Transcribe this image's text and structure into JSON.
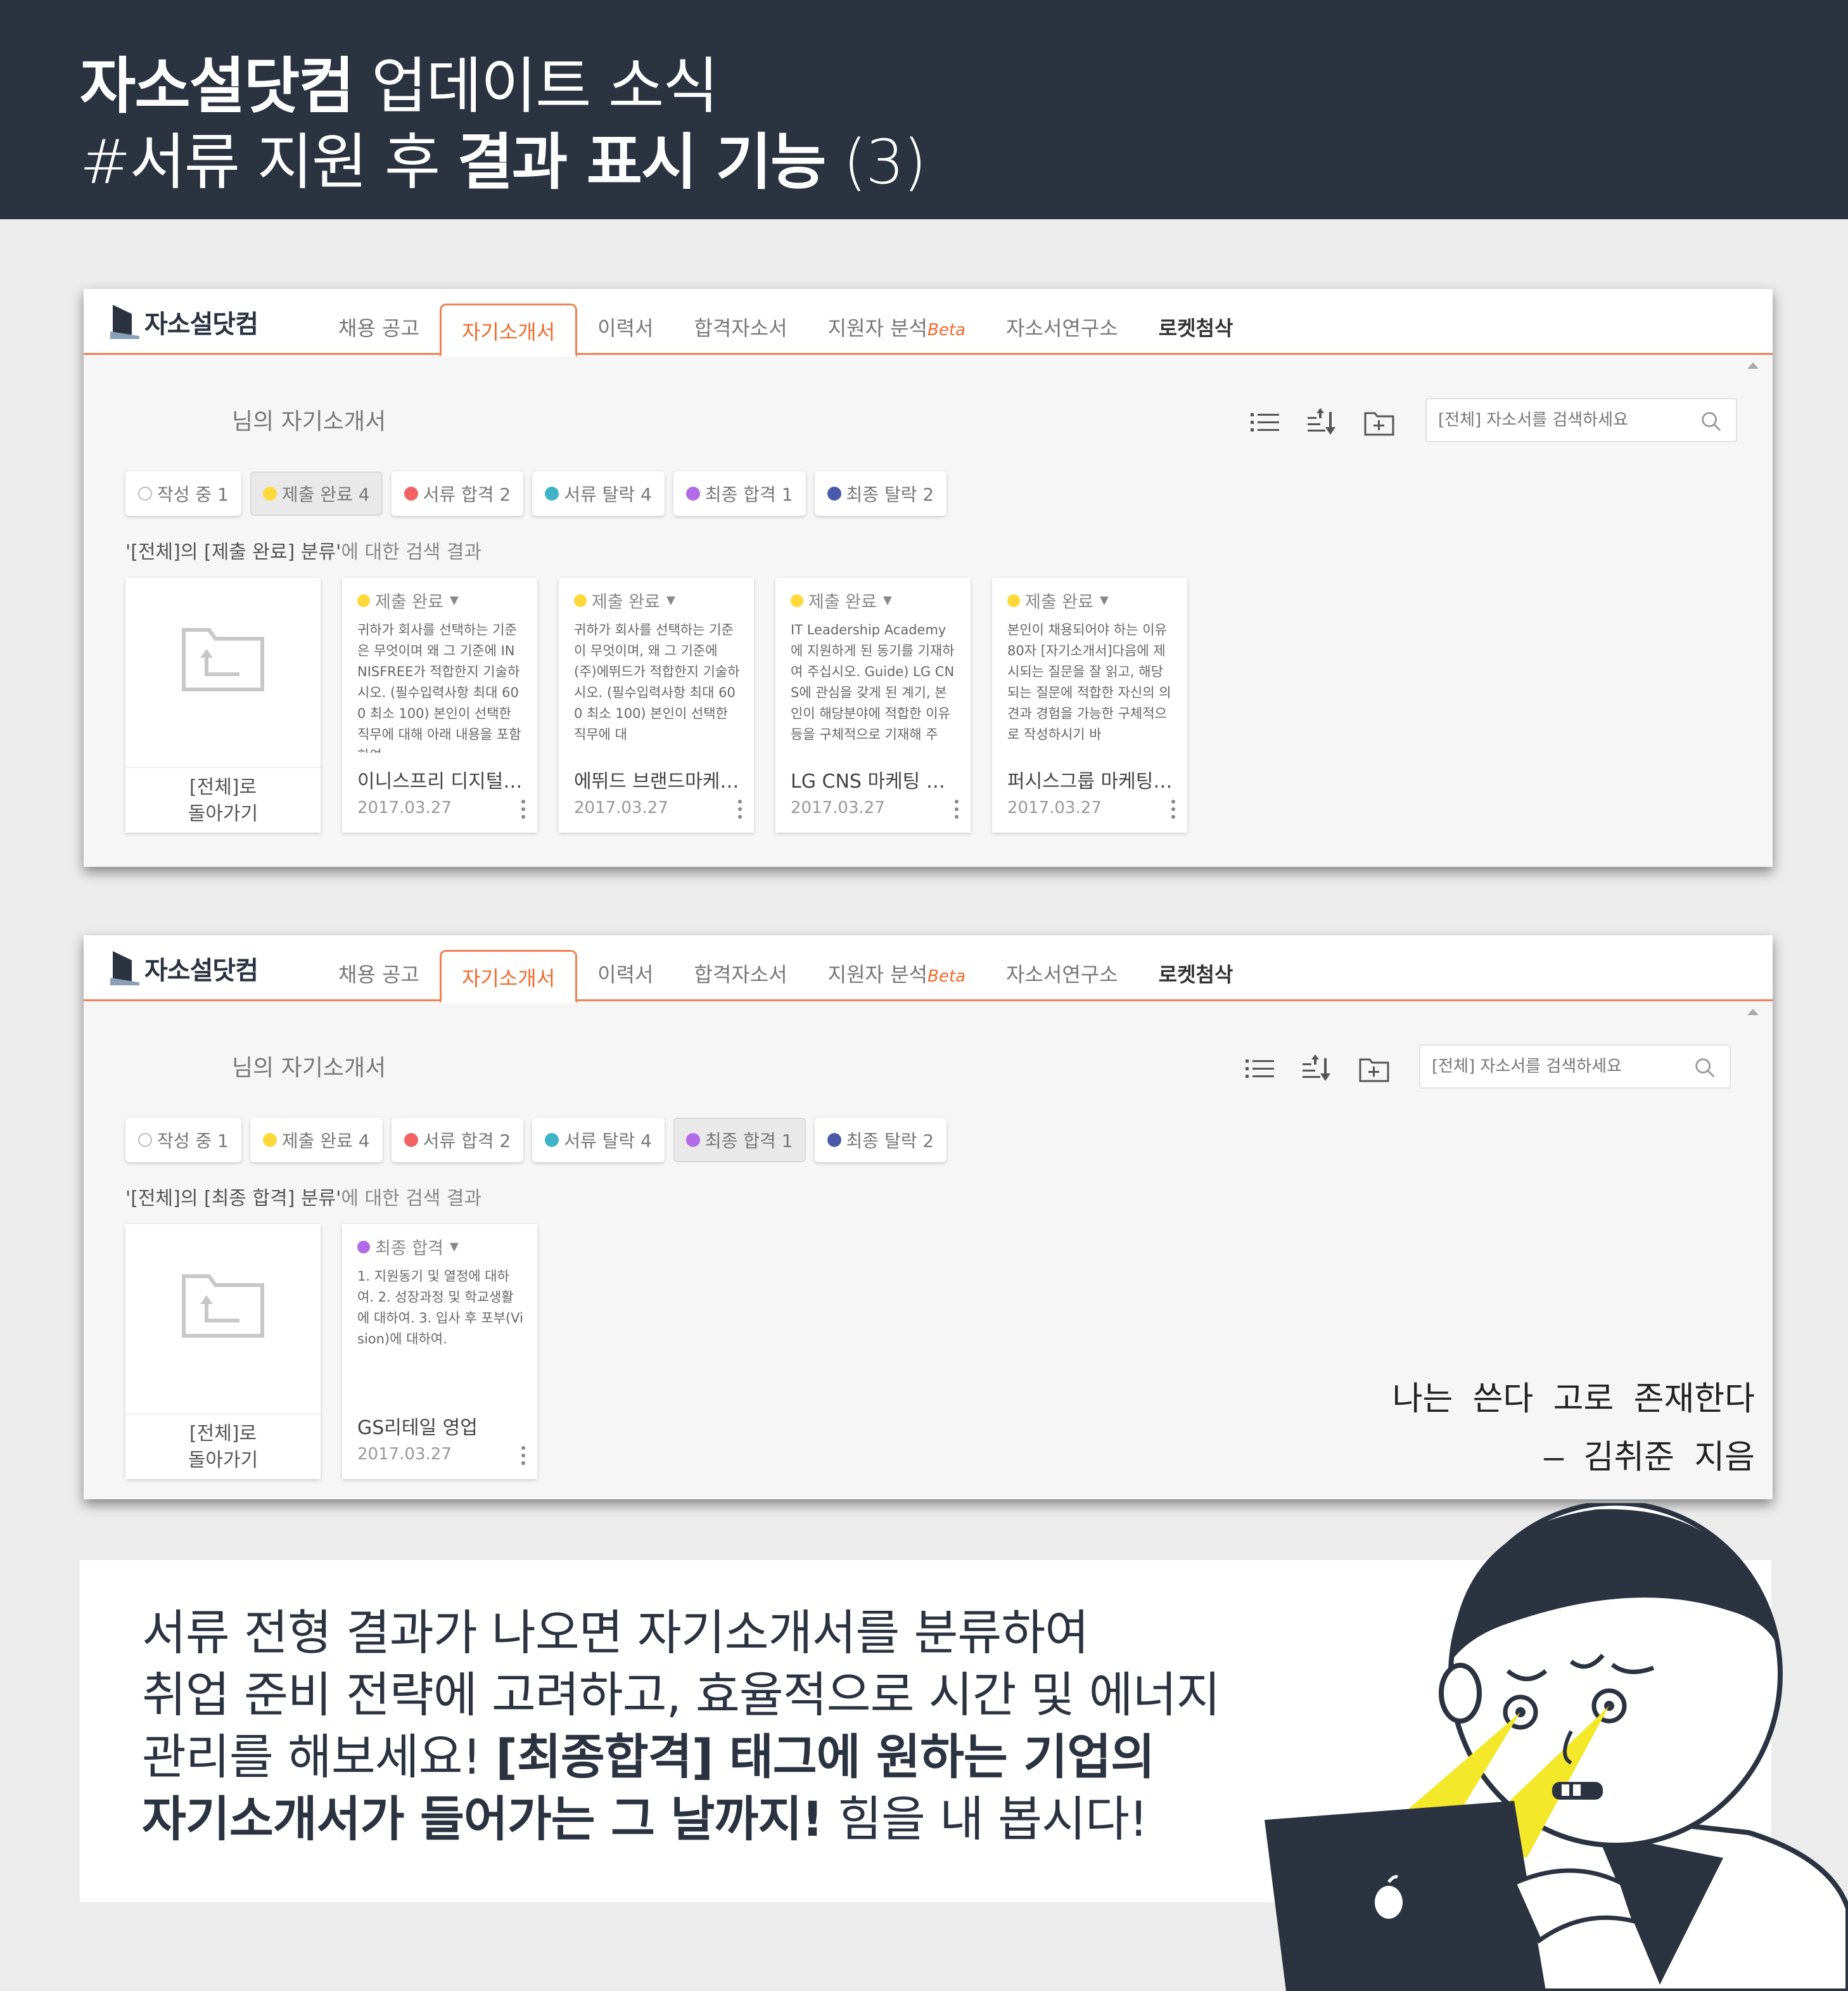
{
  "banner": {
    "line1_bold": "자소설닷컴",
    "line1_rest": " 업데이트 소식",
    "line2_pre": "#서류 지원 후 ",
    "line2_bold": "결과 표시 기능",
    "line2_post": " (3)"
  },
  "site": {
    "logo_text": "자소설닷컴",
    "tabs": [
      {
        "label": "채용 공고"
      },
      {
        "label": "자기소개서"
      },
      {
        "label": "이력서"
      },
      {
        "label": "합격자소서"
      },
      {
        "label": "지원자 분석",
        "badge": "Beta"
      },
      {
        "label": "자소서연구소"
      },
      {
        "label": "로켓첨삭"
      }
    ],
    "owner_label": "님의 자기소개서",
    "search_placeholder": "[전체] 자소서를 검색하세요",
    "icons": [
      "list-view-icon",
      "sort-icon",
      "new-folder-icon",
      "search-icon"
    ]
  },
  "chips": [
    {
      "label": "작성 중 1",
      "color": "hollow"
    },
    {
      "label": "제출 완료 4",
      "color": "#ffd83a"
    },
    {
      "label": "서류 합격 2",
      "color": "#f26464"
    },
    {
      "label": "서류 탈락 4",
      "color": "#3fb4c6"
    },
    {
      "label": "최종 합격 1",
      "color": "#b26ae6"
    },
    {
      "label": "최종 탈락 2",
      "color": "#4b5aa8"
    }
  ],
  "panel1": {
    "selected_chip": 1,
    "result_bold": "'[전체]의 [제출 완료] 분류'",
    "result_rest": "에 대한 검색 결과",
    "back_card": {
      "line1": "[전체]로",
      "line2": "돌아가기"
    },
    "cards": [
      {
        "status": "제출 완료",
        "status_color": "#ffd83a",
        "body": "귀하가 회사를 선택하는 기준은 무엇이며 왜 그 기준에 INNISFREE가 적합한지 기술하시오. (필수입력사항 최대 600 최소 100) 본인이 선택한 직무에 대해 아래 내용을 포함하여",
        "title": "이니스프리 디지털…",
        "date": "2017.03.27"
      },
      {
        "status": "제출 완료",
        "status_color": "#ffd83a",
        "body": "귀하가 회사를 선택하는 기준이 무엇이며, 왜 그 기준에 (주)에뛰드가 적합한지 기술하시오. (필수입력사항 최대 600 최소 100) 본인이 선택한 직무에 대",
        "title": "에뛰드 브랜드마케…",
        "date": "2017.03.27"
      },
      {
        "status": "제출 완료",
        "status_color": "#ffd83a",
        "body": "IT Leadership Academy에 지원하게 된 동기를 기재하여 주십시오. Guide) LG CNS에 관심을 갖게 된 계기, 본인이 해당분야에 적합한 이유 등을 구체적으로 기재해 주",
        "title": "LG CNS 마케팅 운…",
        "date": "2017.03.27"
      },
      {
        "status": "제출 완료",
        "status_color": "#ffd83a",
        "body": "본인이 채용되어야 하는 이유 80자 [자기소개서]다음에 제시되는 질문을 잘 읽고, 해당되는 질문에 적합한 자신의 의견과 경험을 가능한 구체적으로 작성하시기 바",
        "title": "퍼시스그룹 마케팅…",
        "date": "2017.03.27"
      }
    ]
  },
  "panel2": {
    "selected_chip": 4,
    "result_bold": "'[전체]의 [최종 합격] 분류'",
    "result_rest": "에 대한 검색 결과",
    "back_card": {
      "line1": "[전체]로",
      "line2": "돌아가기"
    },
    "cards": [
      {
        "status": "최종 합격",
        "status_color": "#b26ae6",
        "body": "1. 지원동기 및 열정에 대하여. 2. 성장과정 및 학교생활에 대하여. 3. 입사 후 포부(Vision)에 대하여.",
        "title": "GS리테일 영업",
        "date": "2017.03.27"
      }
    ]
  },
  "quote": {
    "line1": "나는 쓴다 고로 존재한다",
    "line2": "– 김취준 지음"
  },
  "message": {
    "line1": "서류 전형 결과가 나오면 자기소개서를 분류하여",
    "line2": "취업 준비 전략에 고려하고, 효율적으로 시간 및 에너지",
    "line3_plain": "관리를 해보세요! ",
    "line3_bold": "[최종합격] 태그에 원하는 기업의",
    "line4_bold": "자기소개서가 들어가는 그 날까지!",
    "line4_plain": " 힘을 내 봅시다!"
  }
}
